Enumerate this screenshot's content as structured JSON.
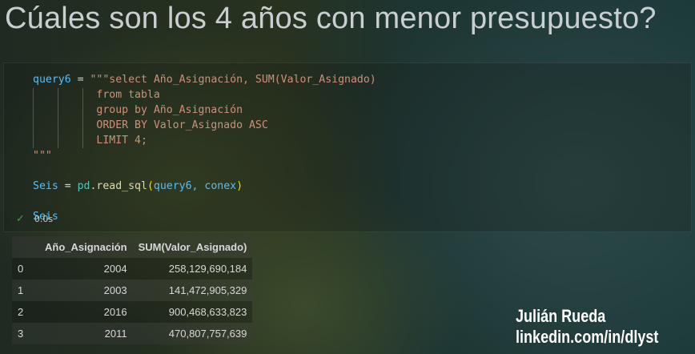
{
  "title": "Cúales son los 4 años con menor presupuesto?",
  "code": {
    "line1_var": "query6",
    "line1_eq": " = ",
    "line1_str": "\"\"\"select Año_Asignación, SUM(Valor_Asignado)",
    "line2": "          from tabla",
    "line3": "          group by Año_Asignación",
    "line4": "          ORDER BY Valor_Asignado ASC",
    "line5": "          LIMIT 4;",
    "line6": "\"\"\"",
    "line7_var": "Seis",
    "line7_eq": " = ",
    "line7_mod": "pd",
    "line7_fn": ".read_sql",
    "line7_open": "(",
    "line7_args": "query6, conex",
    "line7_close": ")",
    "line8": "Seis"
  },
  "status": {
    "icon": "check-icon",
    "time": "0.0s",
    "color": "#3fa14a"
  },
  "table": {
    "headers": [
      "",
      "Año_Asignación",
      "SUM(Valor_Asignado)"
    ],
    "rows": [
      [
        "0",
        "2004",
        "258,129,690,184"
      ],
      [
        "1",
        "2003",
        "141,472,905,329"
      ],
      [
        "2",
        "2016",
        "900,468,633,823"
      ],
      [
        "3",
        "2011",
        "470,807,757,639"
      ]
    ]
  },
  "watermark": {
    "name": "Julián Rueda",
    "link": "linkedin.com/in/dlyst"
  }
}
